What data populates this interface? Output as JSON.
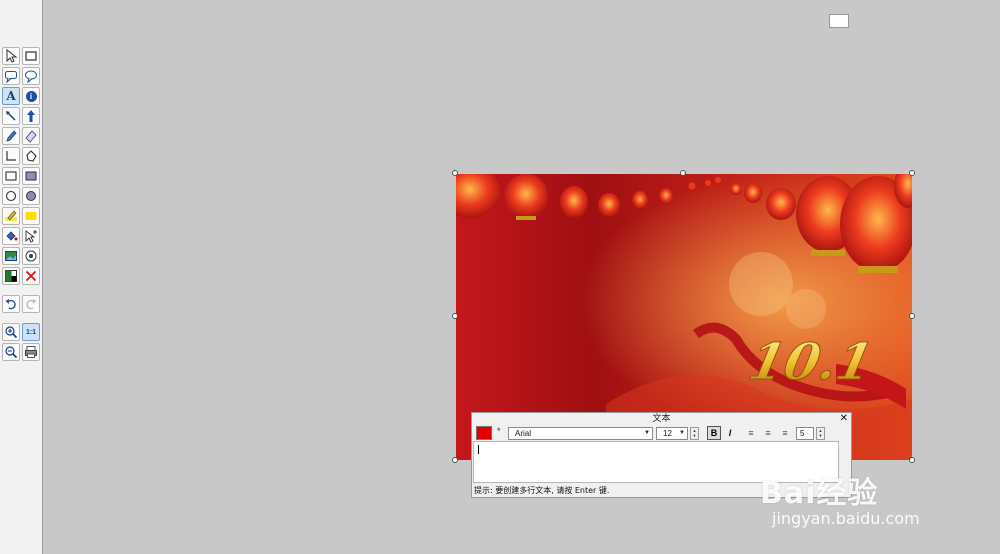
{
  "toolbar": {
    "tools": [
      {
        "name": "select-arrow-icon"
      },
      {
        "name": "select-rect-icon"
      },
      {
        "name": "speech-bubble-icon"
      },
      {
        "name": "speech-bubble-alt-icon"
      },
      {
        "name": "text-tool-icon",
        "label": "A",
        "active": true
      },
      {
        "name": "info-icon",
        "label": "i"
      },
      {
        "name": "line-arrow-icon"
      },
      {
        "name": "arrow-up-icon"
      },
      {
        "name": "pencil-icon"
      },
      {
        "name": "eraser-icon"
      },
      {
        "name": "polyline-icon"
      },
      {
        "name": "polygon-icon"
      },
      {
        "name": "rectangle-icon"
      },
      {
        "name": "filled-rectangle-icon"
      },
      {
        "name": "ellipse-icon"
      },
      {
        "name": "filled-ellipse-icon"
      },
      {
        "name": "highlighter-icon"
      },
      {
        "name": "highlight-rect-icon"
      },
      {
        "name": "fill-bucket-icon"
      },
      {
        "name": "add-pointer-icon"
      },
      {
        "name": "insert-image-icon"
      },
      {
        "name": "stamp-icon"
      },
      {
        "name": "color-swap-icon"
      },
      {
        "name": "delete-icon"
      },
      {
        "name": "undo-icon"
      },
      {
        "name": "redo-icon"
      },
      {
        "name": "zoom-in-icon"
      },
      {
        "name": "actual-size-icon",
        "label": "1:1",
        "active": true
      },
      {
        "name": "zoom-out-icon"
      },
      {
        "name": "print-icon"
      }
    ]
  },
  "image": {
    "graphic_text": "10.1",
    "colors": {
      "bg_dark": "#a10f12",
      "bg_mid": "#d42a18",
      "glow": "#f4a04a",
      "lantern": "#e0241b",
      "gold": "#f2c230"
    }
  },
  "text_panel": {
    "title": "文本",
    "close": "✕",
    "color": "#e00000",
    "star": "*",
    "font": "Arial",
    "size": "12",
    "bold": "B",
    "italic": "I",
    "spacing": "5",
    "hint": "提示: 要创建多行文本, 请按 Enter 键."
  },
  "watermark": {
    "brand": "Bai经验",
    "url": "jingyan.baidu.com"
  }
}
